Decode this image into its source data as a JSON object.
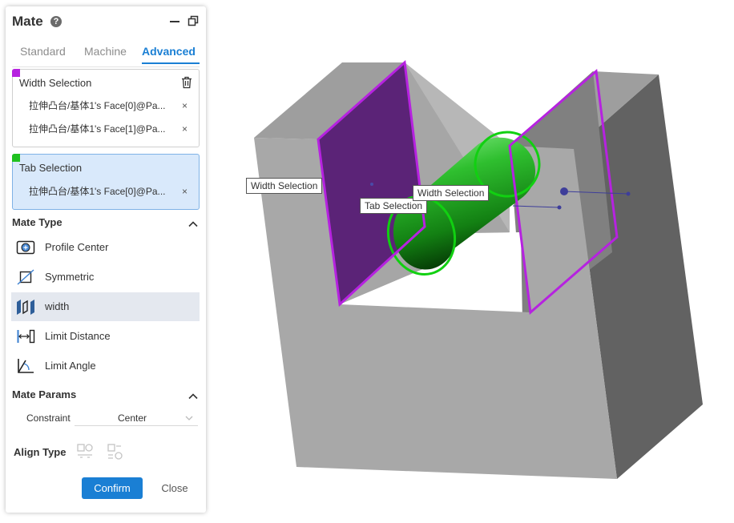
{
  "panel": {
    "title": "Mate",
    "help_icon": "question-circle-icon",
    "tabs": [
      "Standard",
      "Machine",
      "Advanced"
    ],
    "active_tab": "Advanced",
    "width_selection": {
      "title": "Width Selection",
      "color": "#b622e0",
      "items": [
        "拉伸凸台/基体1's Face[0]@Pa...",
        "拉伸凸台/基体1's Face[1]@Pa..."
      ]
    },
    "tab_selection": {
      "title": "Tab Selection",
      "color": "#1fc11f",
      "items": [
        "拉伸凸台/基体1's Face[0]@Pa..."
      ]
    },
    "remove_glyph": "×",
    "mate_type": {
      "title": "Mate Type",
      "items": [
        {
          "label": "Profile Center",
          "icon": "profile-center-icon"
        },
        {
          "label": "Symmetric",
          "icon": "symmetric-icon"
        },
        {
          "label": "width",
          "icon": "width-icon"
        },
        {
          "label": "Limit Distance",
          "icon": "limit-distance-icon"
        },
        {
          "label": "Limit Angle",
          "icon": "limit-angle-icon"
        }
      ],
      "selected": "width"
    },
    "mate_params": {
      "title": "Mate Params",
      "constraint_label": "Constraint",
      "constraint_value": "Center"
    },
    "align_type": {
      "label": "Align Type"
    },
    "buttons": {
      "confirm": "Confirm",
      "close": "Close"
    },
    "accent": "#1a7fd4"
  },
  "viewport": {
    "labels": {
      "width_selection_left": "Width Selection",
      "tab_selection": "Tab Selection",
      "width_selection_right": "Width Selection"
    }
  }
}
